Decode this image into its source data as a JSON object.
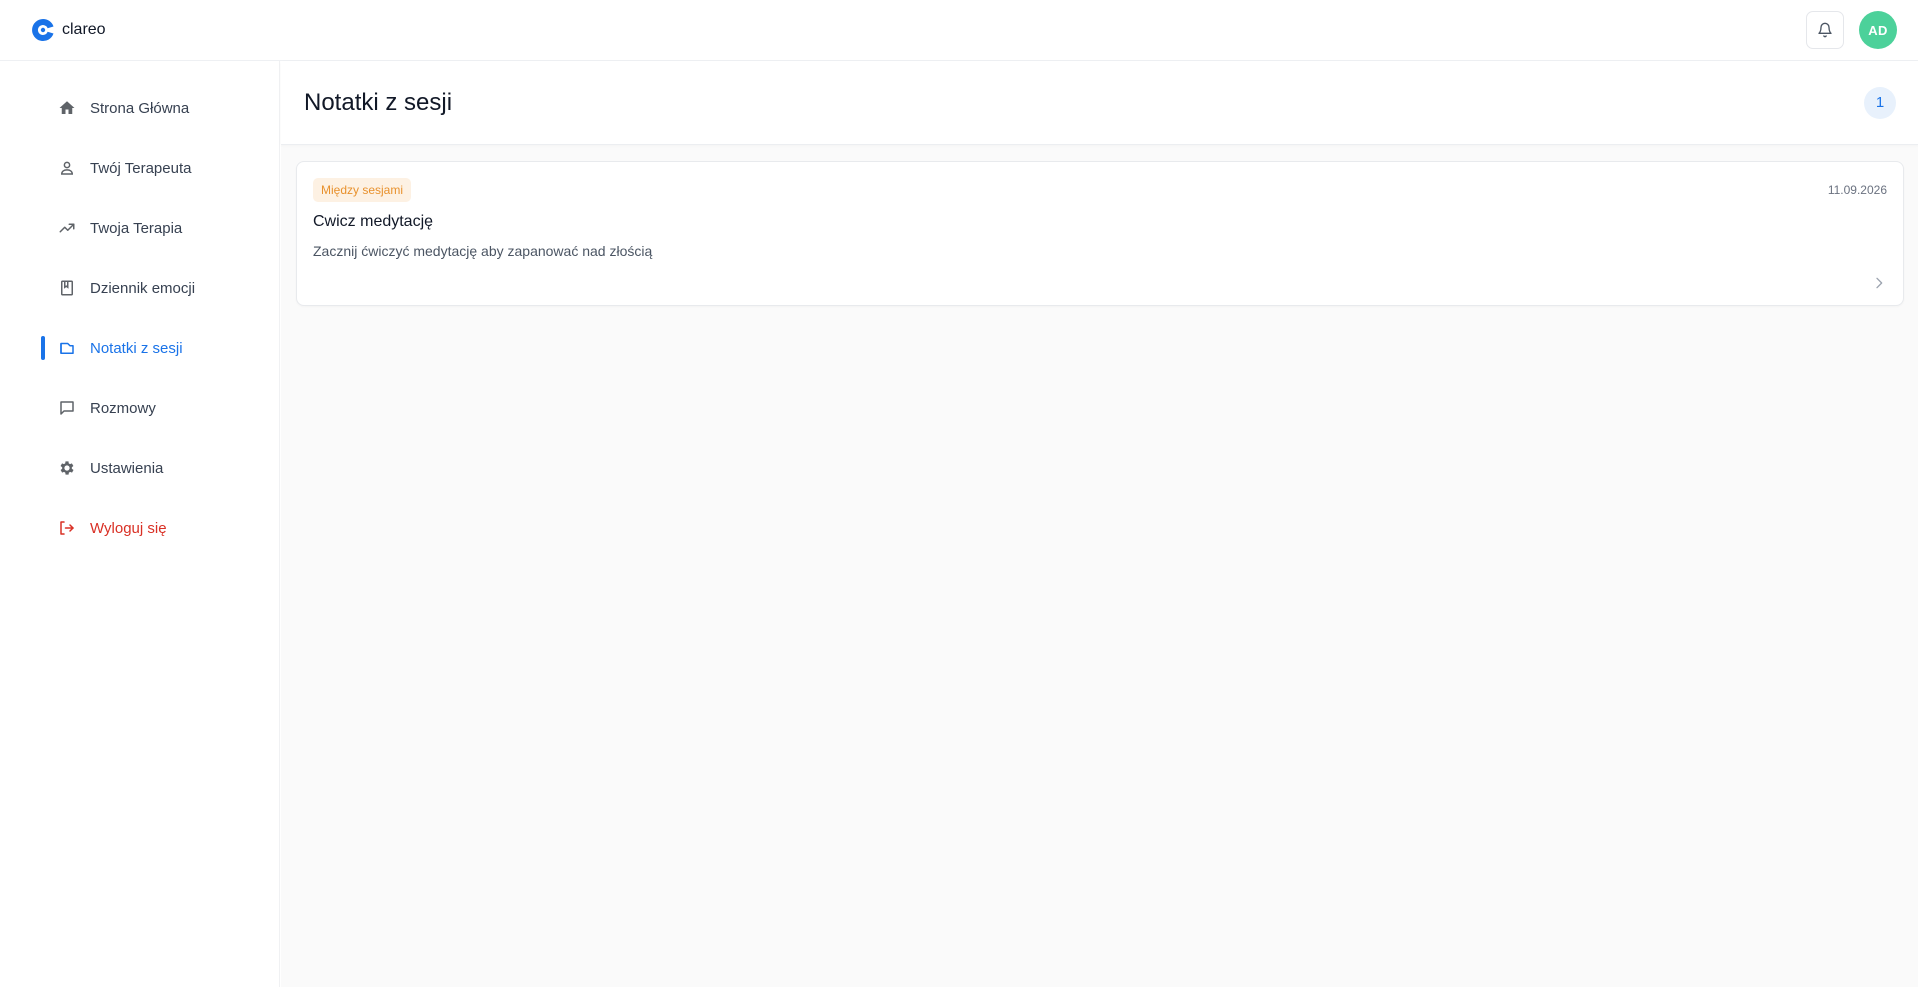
{
  "app": {
    "name": "clareo",
    "logo_icon": "clareo-logo-icon",
    "accent": "#1a73e8"
  },
  "topbar": {
    "bell_icon": "bell-icon",
    "avatar_initials": "AD",
    "avatar_color": "#4cd19a"
  },
  "sidebar": {
    "items": [
      {
        "label": "Strona Główna",
        "icon": "home-icon"
      },
      {
        "label": "Twój Terapeuta",
        "icon": "person-icon"
      },
      {
        "label": "Twoja Terapia",
        "icon": "trending-up-icon"
      },
      {
        "label": "Dziennik emocji",
        "icon": "book-icon"
      },
      {
        "label": "Notatki z sesji",
        "icon": "folder-note-icon",
        "active": true
      },
      {
        "label": "Rozmowy",
        "icon": "chat-icon"
      },
      {
        "label": "Ustawienia",
        "icon": "gear-icon"
      },
      {
        "label": "Wyloguj się",
        "icon": "logout-icon",
        "color": "#d93025"
      }
    ]
  },
  "main": {
    "title": "Notatki z sesji",
    "count": "1",
    "notes": [
      {
        "tag": "Między sesjami",
        "tag_text_color": "#e8912d",
        "tag_bg_color": "#fdf1e3",
        "date": "11.09.2026",
        "title": "Cwicz medytację",
        "description": "Zacznij ćwiczyć medytację aby zapanować nad złością"
      }
    ]
  }
}
